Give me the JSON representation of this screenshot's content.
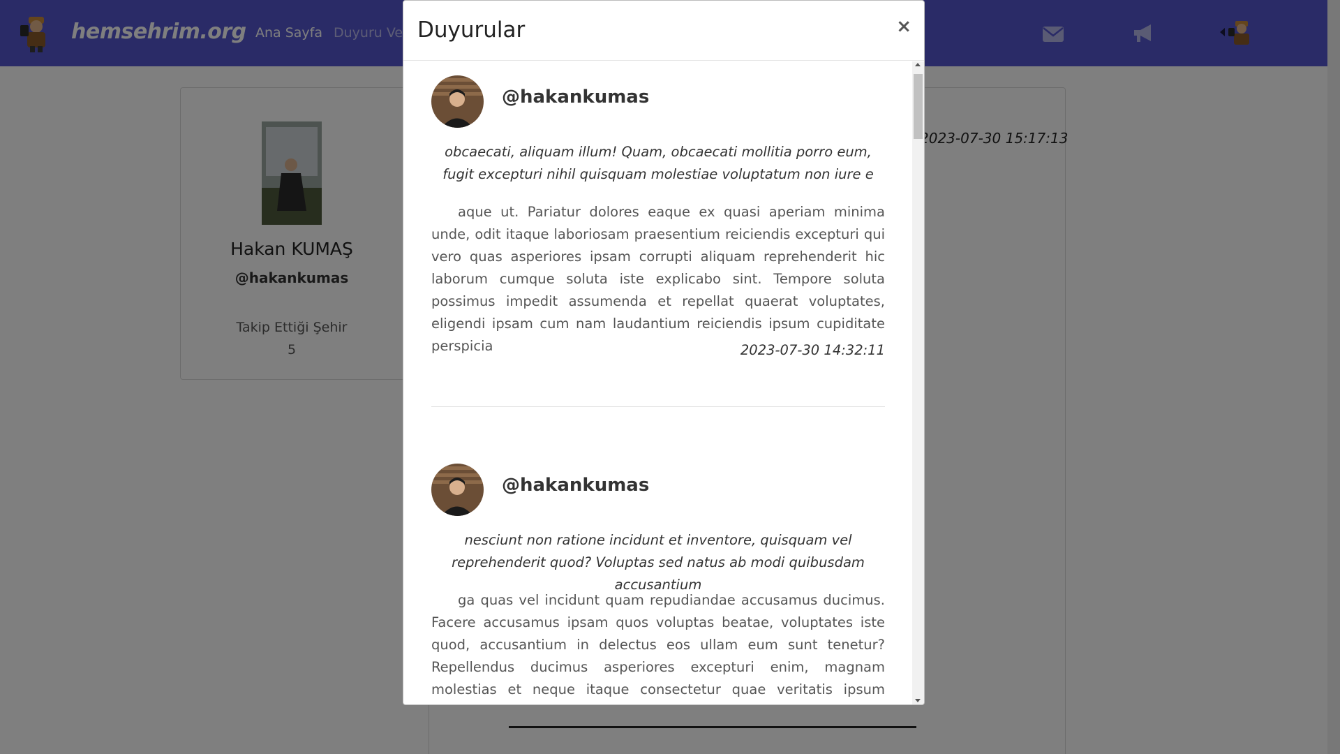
{
  "navbar": {
    "brand": "hemsehrim.org",
    "links": [
      "Ana Sayfa",
      "Duyuru Ve"
    ]
  },
  "profile": {
    "name": "Hakan KUMAŞ",
    "handle": "@hakankumas",
    "follow_label": "Takip Ettiği Şehir",
    "follow_count": "5"
  },
  "feed": {
    "date": "2023-07-30 15:17:13"
  },
  "modal": {
    "title": "Duyurular",
    "close": "×",
    "posts": [
      {
        "handle": "@hakankumas",
        "summary": "obcaecati, aliquam illum! Quam, obcaecati mollitia porro eum, fugit excepturi nihil quisquam molestiae voluptatum non iure e",
        "text": "aque ut. Pariatur dolores eaque ex quasi aperiam minima unde, odit itaque laboriosam praesentium reiciendis excepturi qui vero quas asperiores ipsam corrupti aliquam reprehenderit hic laborum cumque soluta iste explicabo sint. Tempore soluta possimus impedit assumenda et repellat quaerat voluptates, eligendi ipsam cum nam laudantium reiciendis ipsum cupiditate perspicia",
        "date": "2023-07-30 14:32:11"
      },
      {
        "handle": "@hakankumas",
        "summary": "nesciunt non ratione incidunt et inventore, quisquam vel reprehenderit quod? Voluptas sed natus ab modi quibusdam accusantium",
        "text": "ga quas vel incidunt quam repudiandae accusamus ducimus. Facere accusamus ipsam quos voluptas beatae, voluptates iste quod, accusantium in delectus eos ullam eum sunt tenetur? Repellendus ducimus asperiores excepturi enim, magnam molestias et neque itaque consectetur quae veritatis ipsum quidem velit tenetur ad ab rerum veniam! Aliquid eligendi libero alias laudantium dolores, ad fugit ullam"
      }
    ]
  },
  "colors": {
    "navbar": "#5556cf",
    "backdrop": "rgba(0,0,0,0.5)"
  },
  "icons": [
    "envelope-icon",
    "megaphone-icon",
    "caret-left-icon"
  ]
}
